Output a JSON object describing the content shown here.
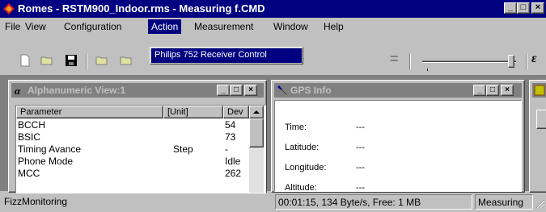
{
  "window": {
    "title": "Romes - RSTM900_Indoor.rms - Measuring f.CMD",
    "minimize_glyph": "_",
    "maximize_glyph": "□",
    "close_glyph": "×"
  },
  "menu": {
    "items": [
      "File",
      "View",
      "Configuration",
      "Action",
      "Measurement",
      "Window",
      "Help"
    ],
    "active": "Action",
    "dropdown": {
      "items": [
        "Philips 752 Receiver Control"
      ]
    }
  },
  "toolbar": {
    "icons": [
      "new-document-icon",
      "open-folder-icon",
      "save-icon",
      "open-config-icon",
      "open-workspace-icon"
    ],
    "right_glyph": "=",
    "italic_glyph": "ε"
  },
  "alphanumeric_view": {
    "title": "Alphanumeric View:1",
    "columns": [
      "Parameter",
      "[Unit]",
      "Dev"
    ],
    "rows": [
      {
        "parameter": "BCCH",
        "unit": "",
        "value": "54"
      },
      {
        "parameter": "BSIC",
        "unit": "",
        "value": "73"
      },
      {
        "parameter": "Timing Avance",
        "unit": "Step",
        "value": "-"
      },
      {
        "parameter": "Phone Mode",
        "unit": "",
        "value": "Idle"
      },
      {
        "parameter": "MCC",
        "unit": "",
        "value": "262"
      }
    ]
  },
  "gps_info": {
    "title": "GPS Info",
    "fields": [
      {
        "label": "Time:",
        "value": "---"
      },
      {
        "label": "Latitude:",
        "value": "---"
      },
      {
        "label": "Longitude:",
        "value": "---"
      },
      {
        "label": "Altitude:",
        "value": "---"
      }
    ]
  },
  "statusbar": {
    "left": "FizzMonitoring",
    "middle": "00:01:15, 134 Byte/s, Free: 1 MB",
    "right": "Measuring"
  },
  "colors": {
    "title_active": "#000080",
    "title_inactive": "#808080",
    "face": "#c0c0c0"
  }
}
